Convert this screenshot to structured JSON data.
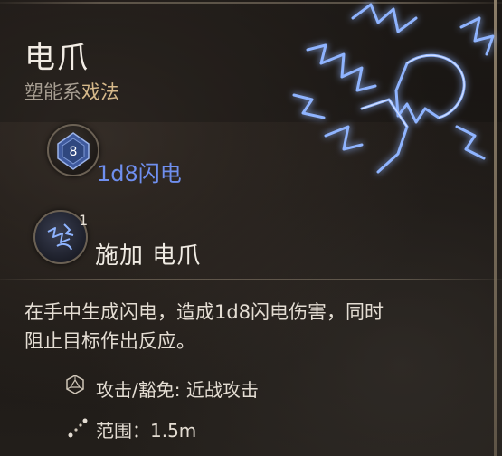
{
  "spell": {
    "name": "电爪",
    "school": "塑能系",
    "spell_type": "戏法"
  },
  "damage": {
    "dice_value": "8",
    "text": "1d8闪电"
  },
  "apply": {
    "count": "1",
    "label": "施加 电爪"
  },
  "description": {
    "line1": "在手中生成闪电，造成1d8闪电伤害，同时",
    "line2": "阻止目标作出反应。"
  },
  "properties": {
    "attack": "攻击/豁免: 近战攻击",
    "range": "范围：1.5m"
  },
  "icons": {
    "dice": "d8-dice-icon",
    "apply": "shocking-grasp-icon",
    "attack": "d20-icon",
    "range": "range-dots-icon",
    "art": "lightning-fist-art"
  },
  "colors": {
    "damage": "#6f8fef",
    "cantrip": "#d6b98a",
    "lightning": "#5b8cff"
  }
}
